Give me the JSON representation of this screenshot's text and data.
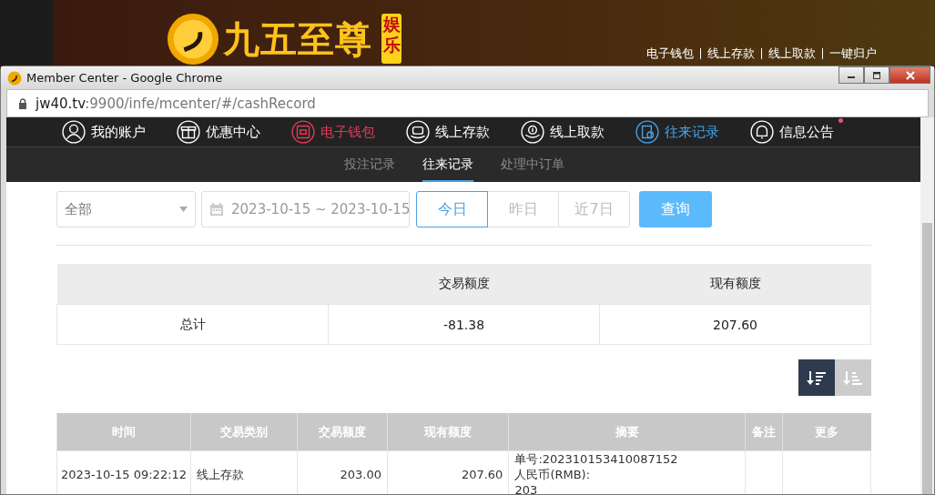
{
  "site": {
    "brand": "九五至尊",
    "brand_sub": "娱乐",
    "links": [
      "电子钱包",
      "线上存款",
      "线上取款",
      "一键归户"
    ]
  },
  "window": {
    "title": "Member Center - Google Chrome",
    "url_host": "jw40.tv",
    "url_path": ":9900/infe/mcenter/#/cashRecord"
  },
  "nav": [
    {
      "label": "我的账户",
      "selected": false,
      "highlighted": false,
      "unread": false
    },
    {
      "label": "优惠中心",
      "selected": false,
      "highlighted": false,
      "unread": false
    },
    {
      "label": "电子钱包",
      "selected": false,
      "highlighted": true,
      "unread": false
    },
    {
      "label": "线上存款",
      "selected": false,
      "highlighted": false,
      "unread": false
    },
    {
      "label": "线上取款",
      "selected": false,
      "highlighted": false,
      "unread": false
    },
    {
      "label": "往来记录",
      "selected": true,
      "highlighted": false,
      "unread": false
    },
    {
      "label": "信息公告",
      "selected": false,
      "highlighted": false,
      "unread": true
    }
  ],
  "subtabs": [
    {
      "label": "投注记录",
      "selected": false
    },
    {
      "label": "往来记录",
      "selected": true
    },
    {
      "label": "处理中订单",
      "selected": false
    }
  ],
  "filter": {
    "type_select": "全部",
    "date_range": "2023-10-15 ~ 2023-10-15",
    "quick_ranges": [
      {
        "label": "今日",
        "selected": true
      },
      {
        "label": "昨日",
        "selected": false
      },
      {
        "label": "近7日",
        "selected": false
      }
    ],
    "query_button": "查询"
  },
  "summary": {
    "columns": [
      "",
      "交易额度",
      "现有额度"
    ],
    "rows": [
      [
        "总计",
        "-81.38",
        "207.60"
      ]
    ]
  },
  "sort_buttons": [
    {
      "kind": "desc",
      "selected": true
    },
    {
      "kind": "asc",
      "selected": false
    }
  ],
  "records": {
    "columns": [
      "时间",
      "交易类别",
      "交易额度",
      "现有额度",
      "摘要",
      "备注",
      "更多"
    ],
    "rows": [
      {
        "time": "2023-10-15 09:22:12",
        "type": "线上存款",
        "amount": "203.00",
        "balance": "207.60",
        "summary": [
          "单号:202310153410087152",
          "人民币(RMB):",
          "203"
        ]
      }
    ]
  }
}
